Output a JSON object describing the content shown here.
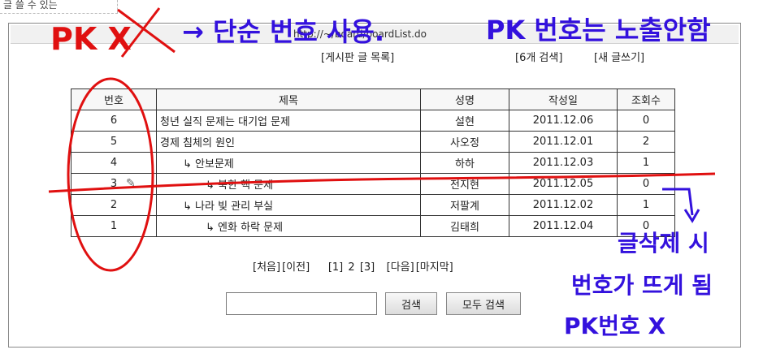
{
  "corner_text": "글 쓸 수 있는",
  "address": {
    "url": "http://~/board/boardList.do"
  },
  "toolbar": {
    "list_link": "[게시판   글 목록]",
    "search_count": "[6개 검색]",
    "new_post": "[새 글쓰기]"
  },
  "table": {
    "headers": [
      "번호",
      "제목",
      "성명",
      "작성일",
      "조회수"
    ],
    "rows": [
      {
        "no": "6",
        "title": "청년 실직 문제는 대기업 문제",
        "indent": 0,
        "name": "설현",
        "date": "2011.12.06",
        "views": "0"
      },
      {
        "no": "5",
        "title": "경제 침체의 원인",
        "indent": 0,
        "name": "사오정",
        "date": "2011.12.01",
        "views": "2"
      },
      {
        "no": "4",
        "title": "↳ 안보문제",
        "indent": 1,
        "name": "하하",
        "date": "2011.12.03",
        "views": "1"
      },
      {
        "no": "3",
        "title": "↳ 북한 핵 문제",
        "indent": 2,
        "name": "전지현",
        "date": "2011.12.05",
        "views": "0"
      },
      {
        "no": "2",
        "title": "↳ 나라 빚 관리 부실",
        "indent": 1,
        "name": "저팔계",
        "date": "2011.12.02",
        "views": "1"
      },
      {
        "no": "1",
        "title": "↳ 엔화 하락 문제",
        "indent": 2,
        "name": "김태희",
        "date": "2011.12.04",
        "views": "0"
      }
    ]
  },
  "pager": {
    "first": "[처음]",
    "prev": "[이전]",
    "pages": [
      "[1]",
      "2",
      "[3]"
    ],
    "next": "[다음]",
    "last": "[마지막]"
  },
  "search": {
    "value": "",
    "button": "검색",
    "all_button": "모두 검색"
  },
  "annotations": {
    "pk_x": "PK  X",
    "arrow_note": "→ 단순 번호 사용.",
    "pk_hidden": "PK 번호는 노출안함",
    "delete_note1": "글삭제 시",
    "delete_note2": "번호가 뜨게 됨",
    "delete_note3": "PK번호 X",
    "colors": {
      "red": "#e01010",
      "blue": "#3311dd"
    }
  }
}
